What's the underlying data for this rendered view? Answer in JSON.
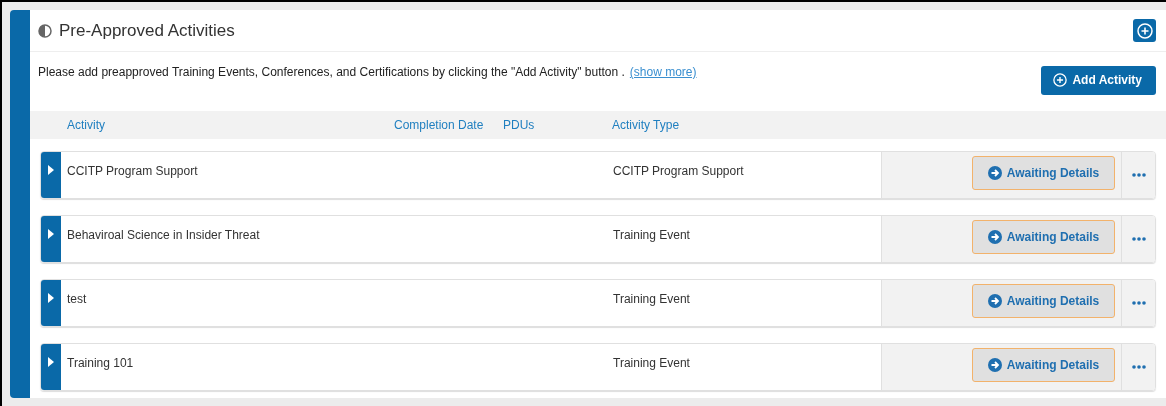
{
  "panel": {
    "title": "Pre-Approved Activities",
    "description": "Please add preapproved Training Events, Conferences, and Certifications by clicking the \"Add Activity\" button .",
    "show_more": "(show more)",
    "add_button": "Add Activity"
  },
  "columns": [
    "Activity",
    "Completion Date",
    "PDUs",
    "Activity Type"
  ],
  "rows": [
    {
      "activity": "CCITP Program Support",
      "type": "CCITP Program Support",
      "status": "Awaiting Details",
      "expanded": false
    },
    {
      "activity": "Behaviroal Science in Insider Threat",
      "type": "Training Event",
      "status": "Awaiting Details",
      "expanded": false
    },
    {
      "activity": "test",
      "type": "Training Event",
      "status": "Awaiting Details",
      "expanded": false
    },
    {
      "activity": "Training 101",
      "type": "Training Event",
      "status": "Awaiting Details",
      "expanded": false
    }
  ]
}
